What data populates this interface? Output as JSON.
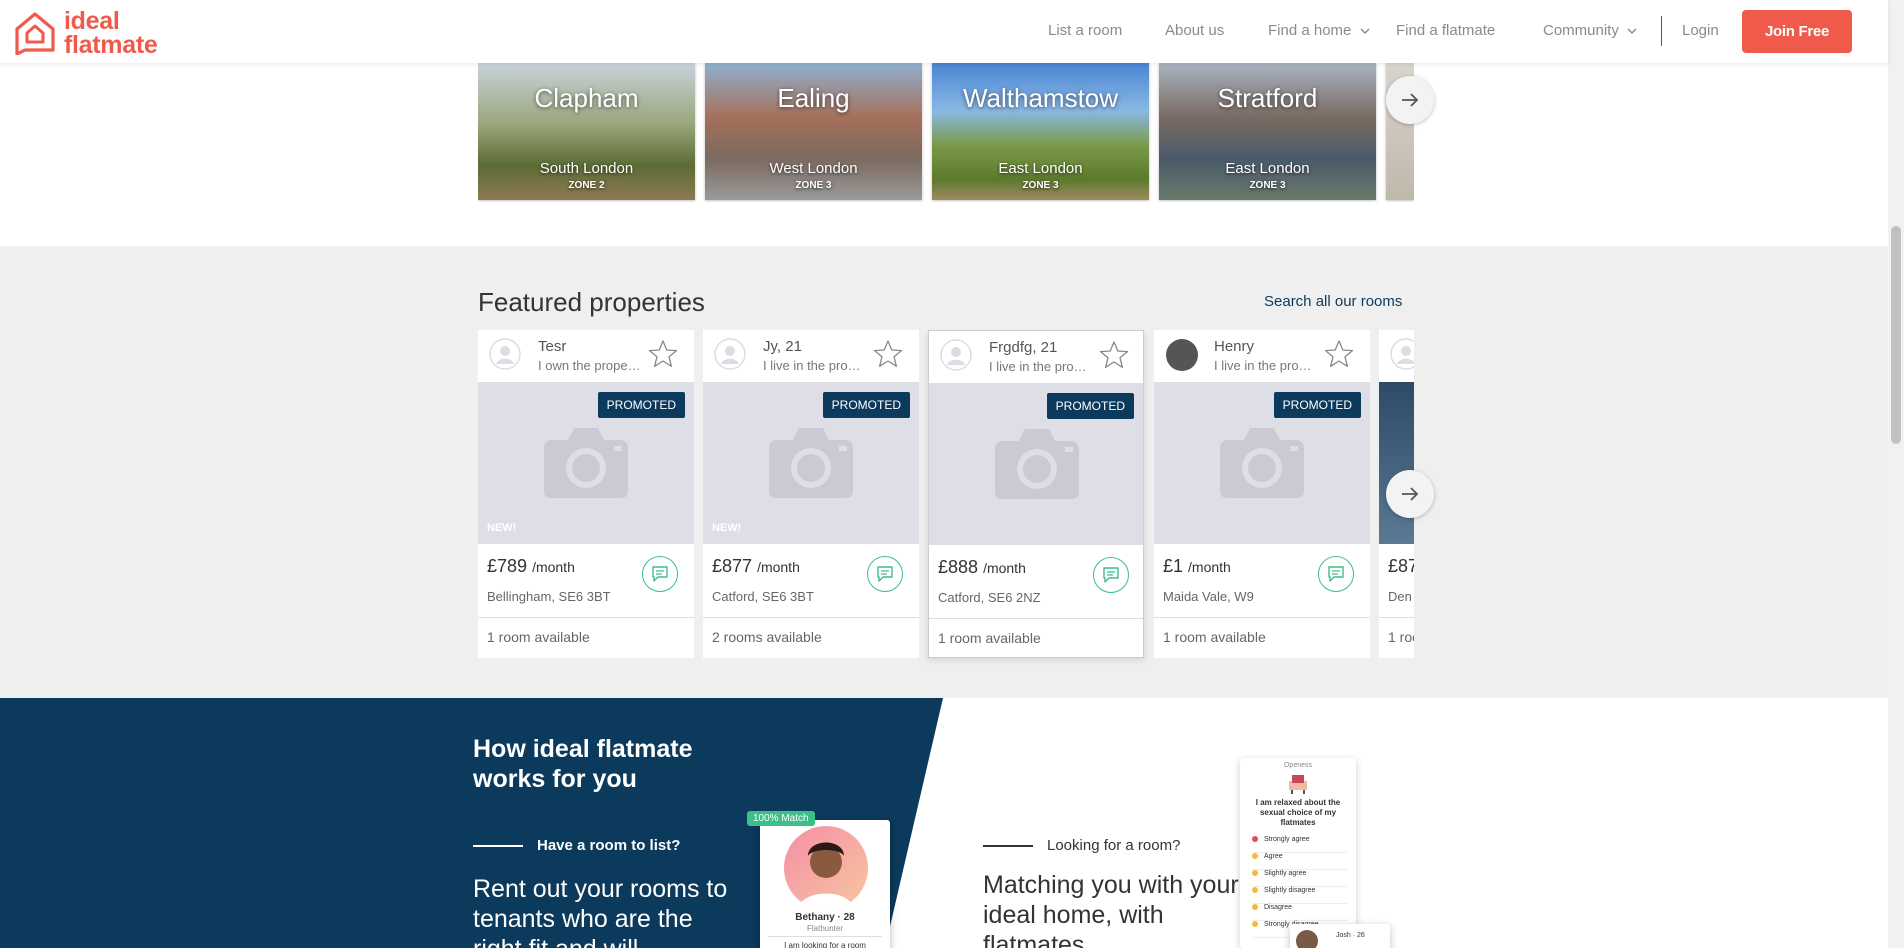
{
  "brand": {
    "line1": "ideal",
    "line2": "flatmate",
    "color": "#f05a4b"
  },
  "nav": {
    "list_room": "List a room",
    "about": "About us",
    "find_home": "Find a home",
    "find_flatmate": "Find a flatmate",
    "community": "Community",
    "login": "Login",
    "join": "Join Free"
  },
  "areas": [
    {
      "name": "Clapham",
      "region": "South London",
      "zone": "ZONE 2"
    },
    {
      "name": "Ealing",
      "region": "West London",
      "zone": "ZONE 3"
    },
    {
      "name": "Walthamstow",
      "region": "East London",
      "zone": "ZONE 3"
    },
    {
      "name": "Stratford",
      "region": "East London",
      "zone": "ZONE 3"
    }
  ],
  "featured": {
    "title": "Featured properties",
    "search_link": "Search all our rooms",
    "cards": [
      {
        "name": "Tesr",
        "desc": "I own the property",
        "promo": "PROMOTED",
        "new": "NEW!",
        "price": "£789",
        "per": "/month",
        "location": "Bellingham, SE6 3BT",
        "rooms": "1 room available"
      },
      {
        "name": "Jy, 21",
        "desc": "I live in the property",
        "promo": "PROMOTED",
        "new": "NEW!",
        "price": "£877",
        "per": "/month",
        "location": "Catford, SE6 3BT",
        "rooms": "2 rooms available"
      },
      {
        "name": "Frgdfg, 21",
        "desc": "I live in the property",
        "promo": "PROMOTED",
        "new": "",
        "price": "£888",
        "per": "/month",
        "location": "Catford, SE6 2NZ",
        "rooms": "1 room available"
      },
      {
        "name": "Henry",
        "desc": "I live in the property",
        "promo": "PROMOTED",
        "new": "",
        "price": "£1",
        "per": "/month",
        "location": "Maida Vale, W9",
        "rooms": "1 room available"
      },
      {
        "name": "",
        "desc": "",
        "promo": "",
        "new": "",
        "price": "£87",
        "per": "",
        "location": "Den",
        "rooms": "1 roo"
      }
    ]
  },
  "how": {
    "title": "How ideal flatmate works for you",
    "left_sub": "Have a room to list?",
    "left_body": "Rent out your rooms to tenants who are the right fit and will",
    "right_sub": "Looking for a room?",
    "right_body": "Matching you with your ideal home, with flatmates",
    "match_badge": "100% Match",
    "match_name": "Bethany · 28",
    "match_role": "Flathunter",
    "match_text": "I am looking for a room",
    "q_head": "Openess",
    "q_title": "I am relaxed about the sexual choice of my flatmates",
    "q_options": [
      "Strongly agree",
      "Agree",
      "Slightly agree",
      "Slightly disagree",
      "Disagree",
      "Strongly disagree"
    ],
    "josh": "Josh · 26"
  },
  "colors": {
    "accent": "#f05a4b",
    "navy": "#0b3a5c",
    "green": "#3dbf8a"
  }
}
